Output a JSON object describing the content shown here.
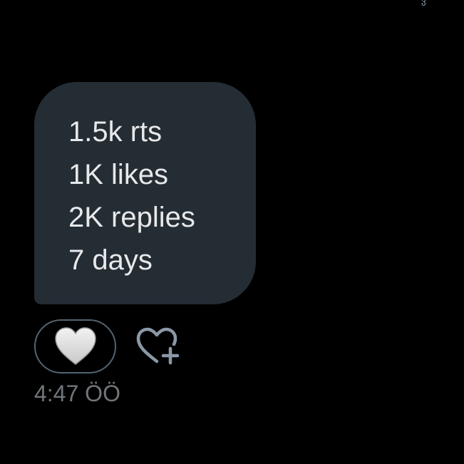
{
  "status": {
    "corner_glyph": "ვ"
  },
  "message": {
    "lines": [
      "1.5k rts",
      "1K likes",
      "2K replies",
      "7 days"
    ],
    "bubble_color": "#242c34",
    "text_color": "#e7e9ea",
    "timestamp": "4:47 ÖÖ"
  },
  "reactions": {
    "active_reaction_icon": "white-heart-icon",
    "add_reaction_icon": "heart-plus-icon",
    "accent_color": "#536471"
  }
}
